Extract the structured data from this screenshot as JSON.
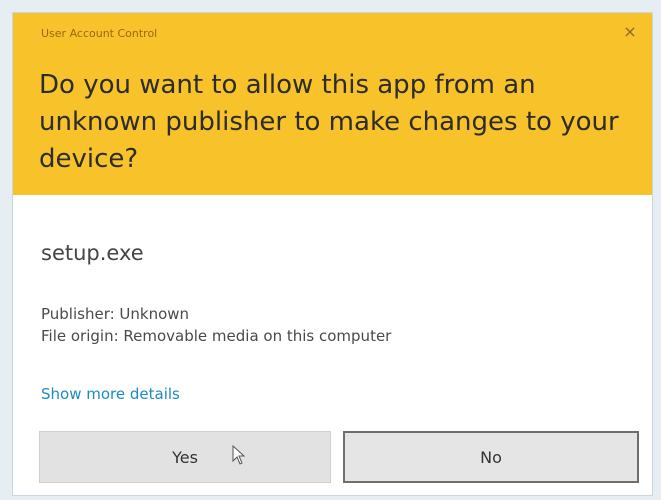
{
  "dialog": {
    "caption": "User Account Control",
    "question": "Do you want to allow this app from an unknown publisher to make changes to your device?",
    "app_name": "setup.exe",
    "publisher_line": "Publisher: Unknown",
    "origin_line": "File origin: Removable media on this computer",
    "details_link": "Show more details",
    "yes_label": "Yes",
    "no_label": "No",
    "close_glyph": "×"
  },
  "icons": {
    "close": "close-icon",
    "cursor": "pointer-cursor-icon"
  },
  "colors": {
    "header_background": "#f7c22a",
    "link": "#1b8ac6",
    "dialog_background": "#ffffff"
  }
}
